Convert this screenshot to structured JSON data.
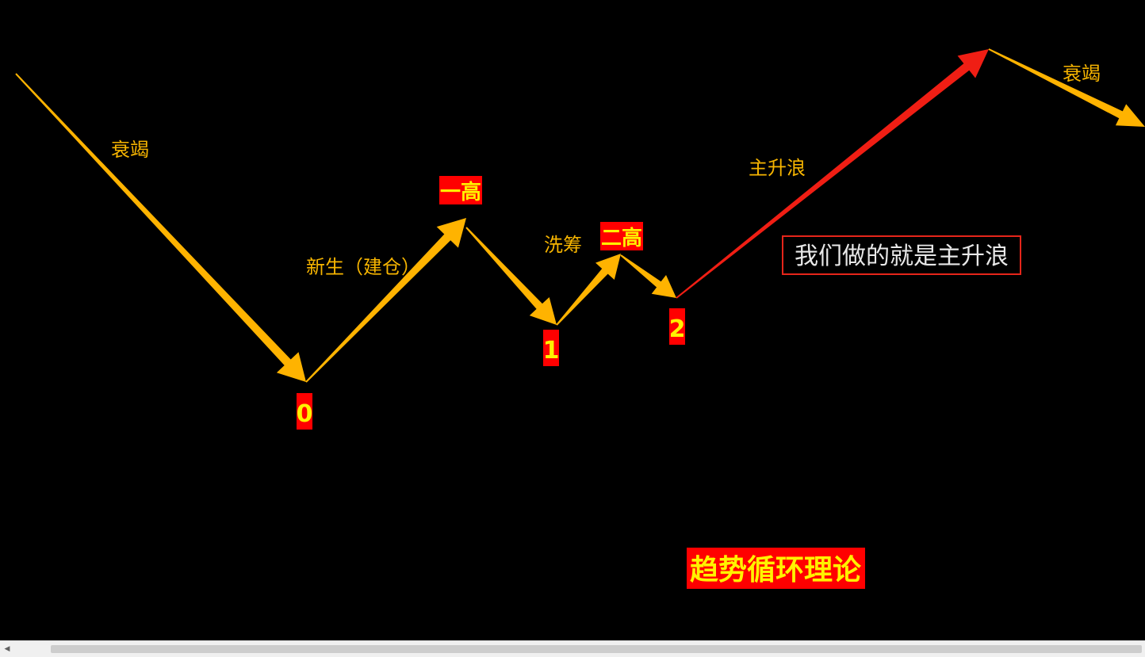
{
  "labels": {
    "decline_left": "衰竭",
    "birth": "新生（建仓）",
    "shakeout": "洗筹",
    "main_rise": "主升浪",
    "decline_right": "衰竭",
    "note": "我们做的就是主升浪",
    "title": "趋势循环理论"
  },
  "markers": {
    "point_0": "0",
    "point_1": "1",
    "point_2": "2",
    "first_high": "一高",
    "second_high": "二高"
  },
  "colors": {
    "arrow_orange": "#FFB300",
    "arrow_red": "#F01E14",
    "label_orange": "#F7B500",
    "marker_bg": "#FF0000",
    "marker_text": "#FFF200",
    "note_text": "#E8E8E8",
    "background": "#000000"
  }
}
